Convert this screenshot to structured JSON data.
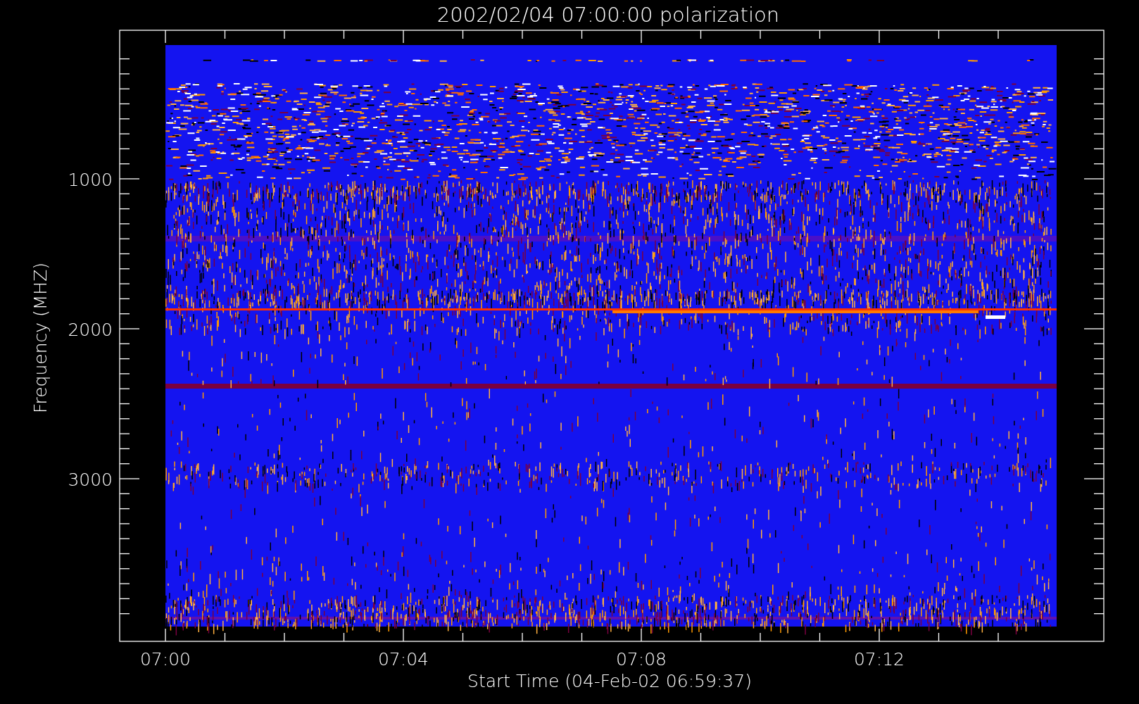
{
  "title": "2002/02/04 07:00:00 polarization",
  "y_axis": {
    "label": "Frequency (MHZ)",
    "ticks": [
      "1000",
      "2000",
      "3000"
    ]
  },
  "x_axis": {
    "label": "Start Time (04-Feb-02 06:59:37)",
    "ticks": [
      "07:00",
      "07:04",
      "07:08",
      "07:12"
    ]
  }
}
